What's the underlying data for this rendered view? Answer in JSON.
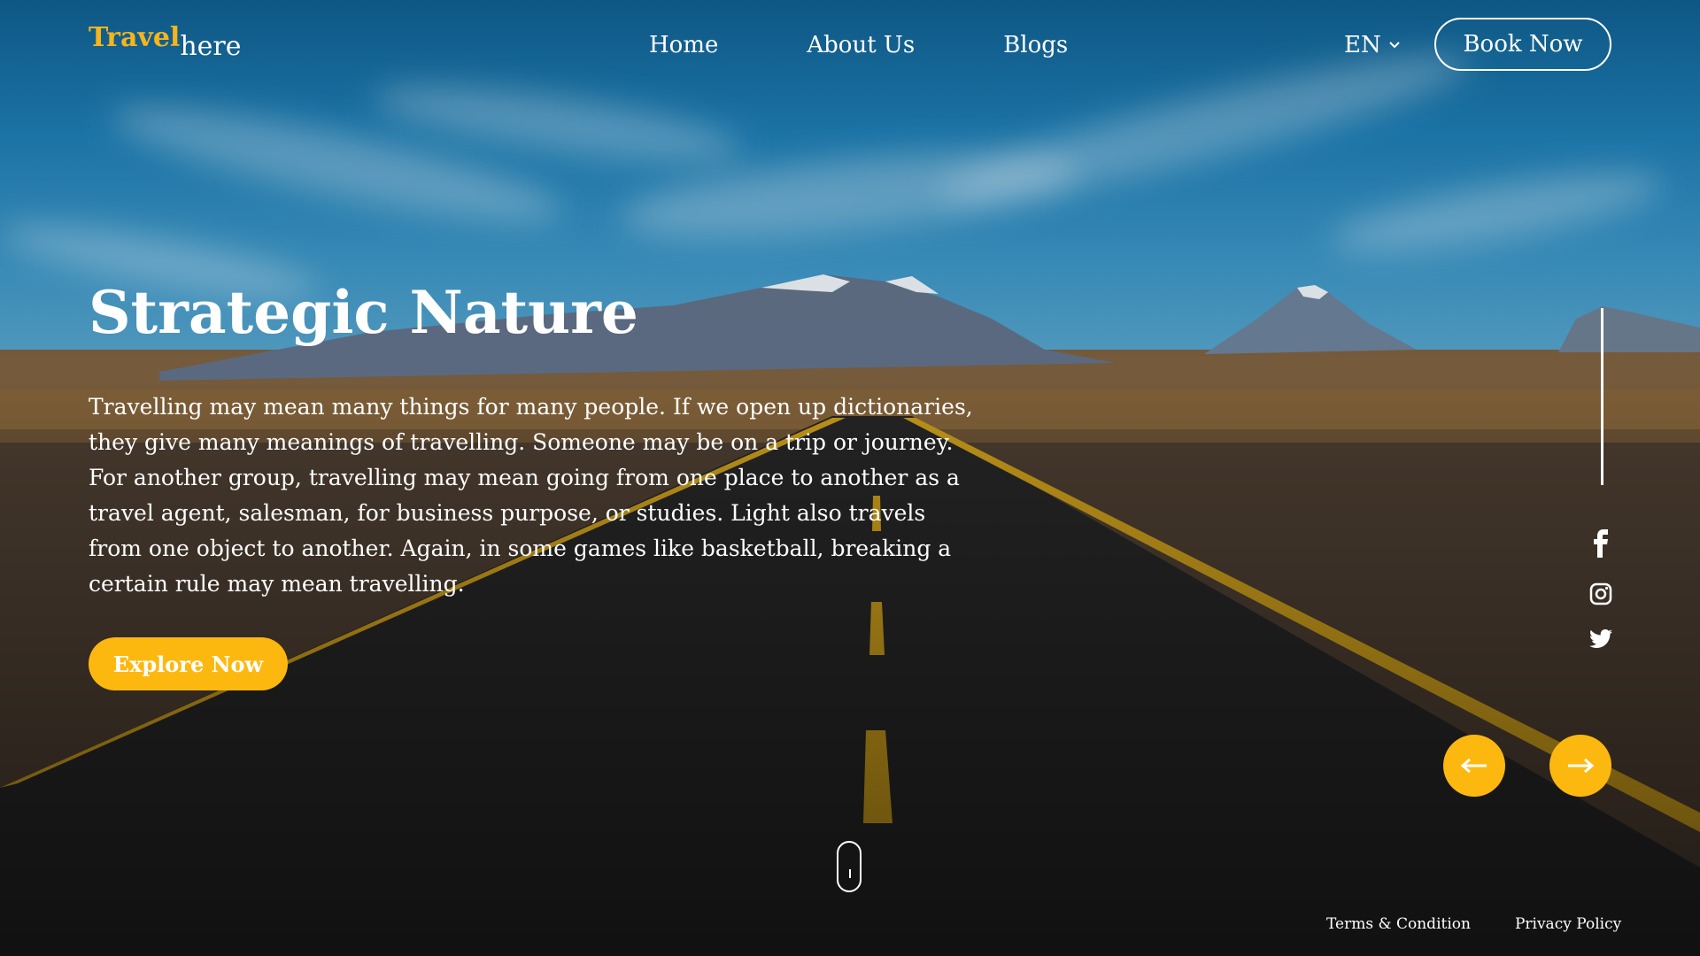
{
  "brand": {
    "name_main": "Travel",
    "name_sub": "here",
    "accent_color": "#fdb810"
  },
  "nav": {
    "links": [
      "Home",
      "About Us",
      "Blogs"
    ],
    "language": "EN",
    "book_label": "Book Now"
  },
  "hero": {
    "title": "Strategic Nature",
    "text": "Travelling may mean many things for many people. If we open up dictionaries, they give many meanings of travelling. Someone may be on a trip or journey. For another group, travelling may mean going from one place to another as a travel agent, salesman, for business purpose, or studies. Light also travels from one object to another. Again, in some games like basketball, breaking a certain rule may mean travelling.",
    "cta_label": "Explore Now"
  },
  "social": {
    "icons": [
      "facebook-icon",
      "instagram-icon",
      "twitter-icon"
    ]
  },
  "slider": {
    "prev_icon": "arrow-left-icon",
    "next_icon": "arrow-right-icon"
  },
  "footer": {
    "terms": "Terms & Condition",
    "privacy": "Privacy Policy"
  }
}
